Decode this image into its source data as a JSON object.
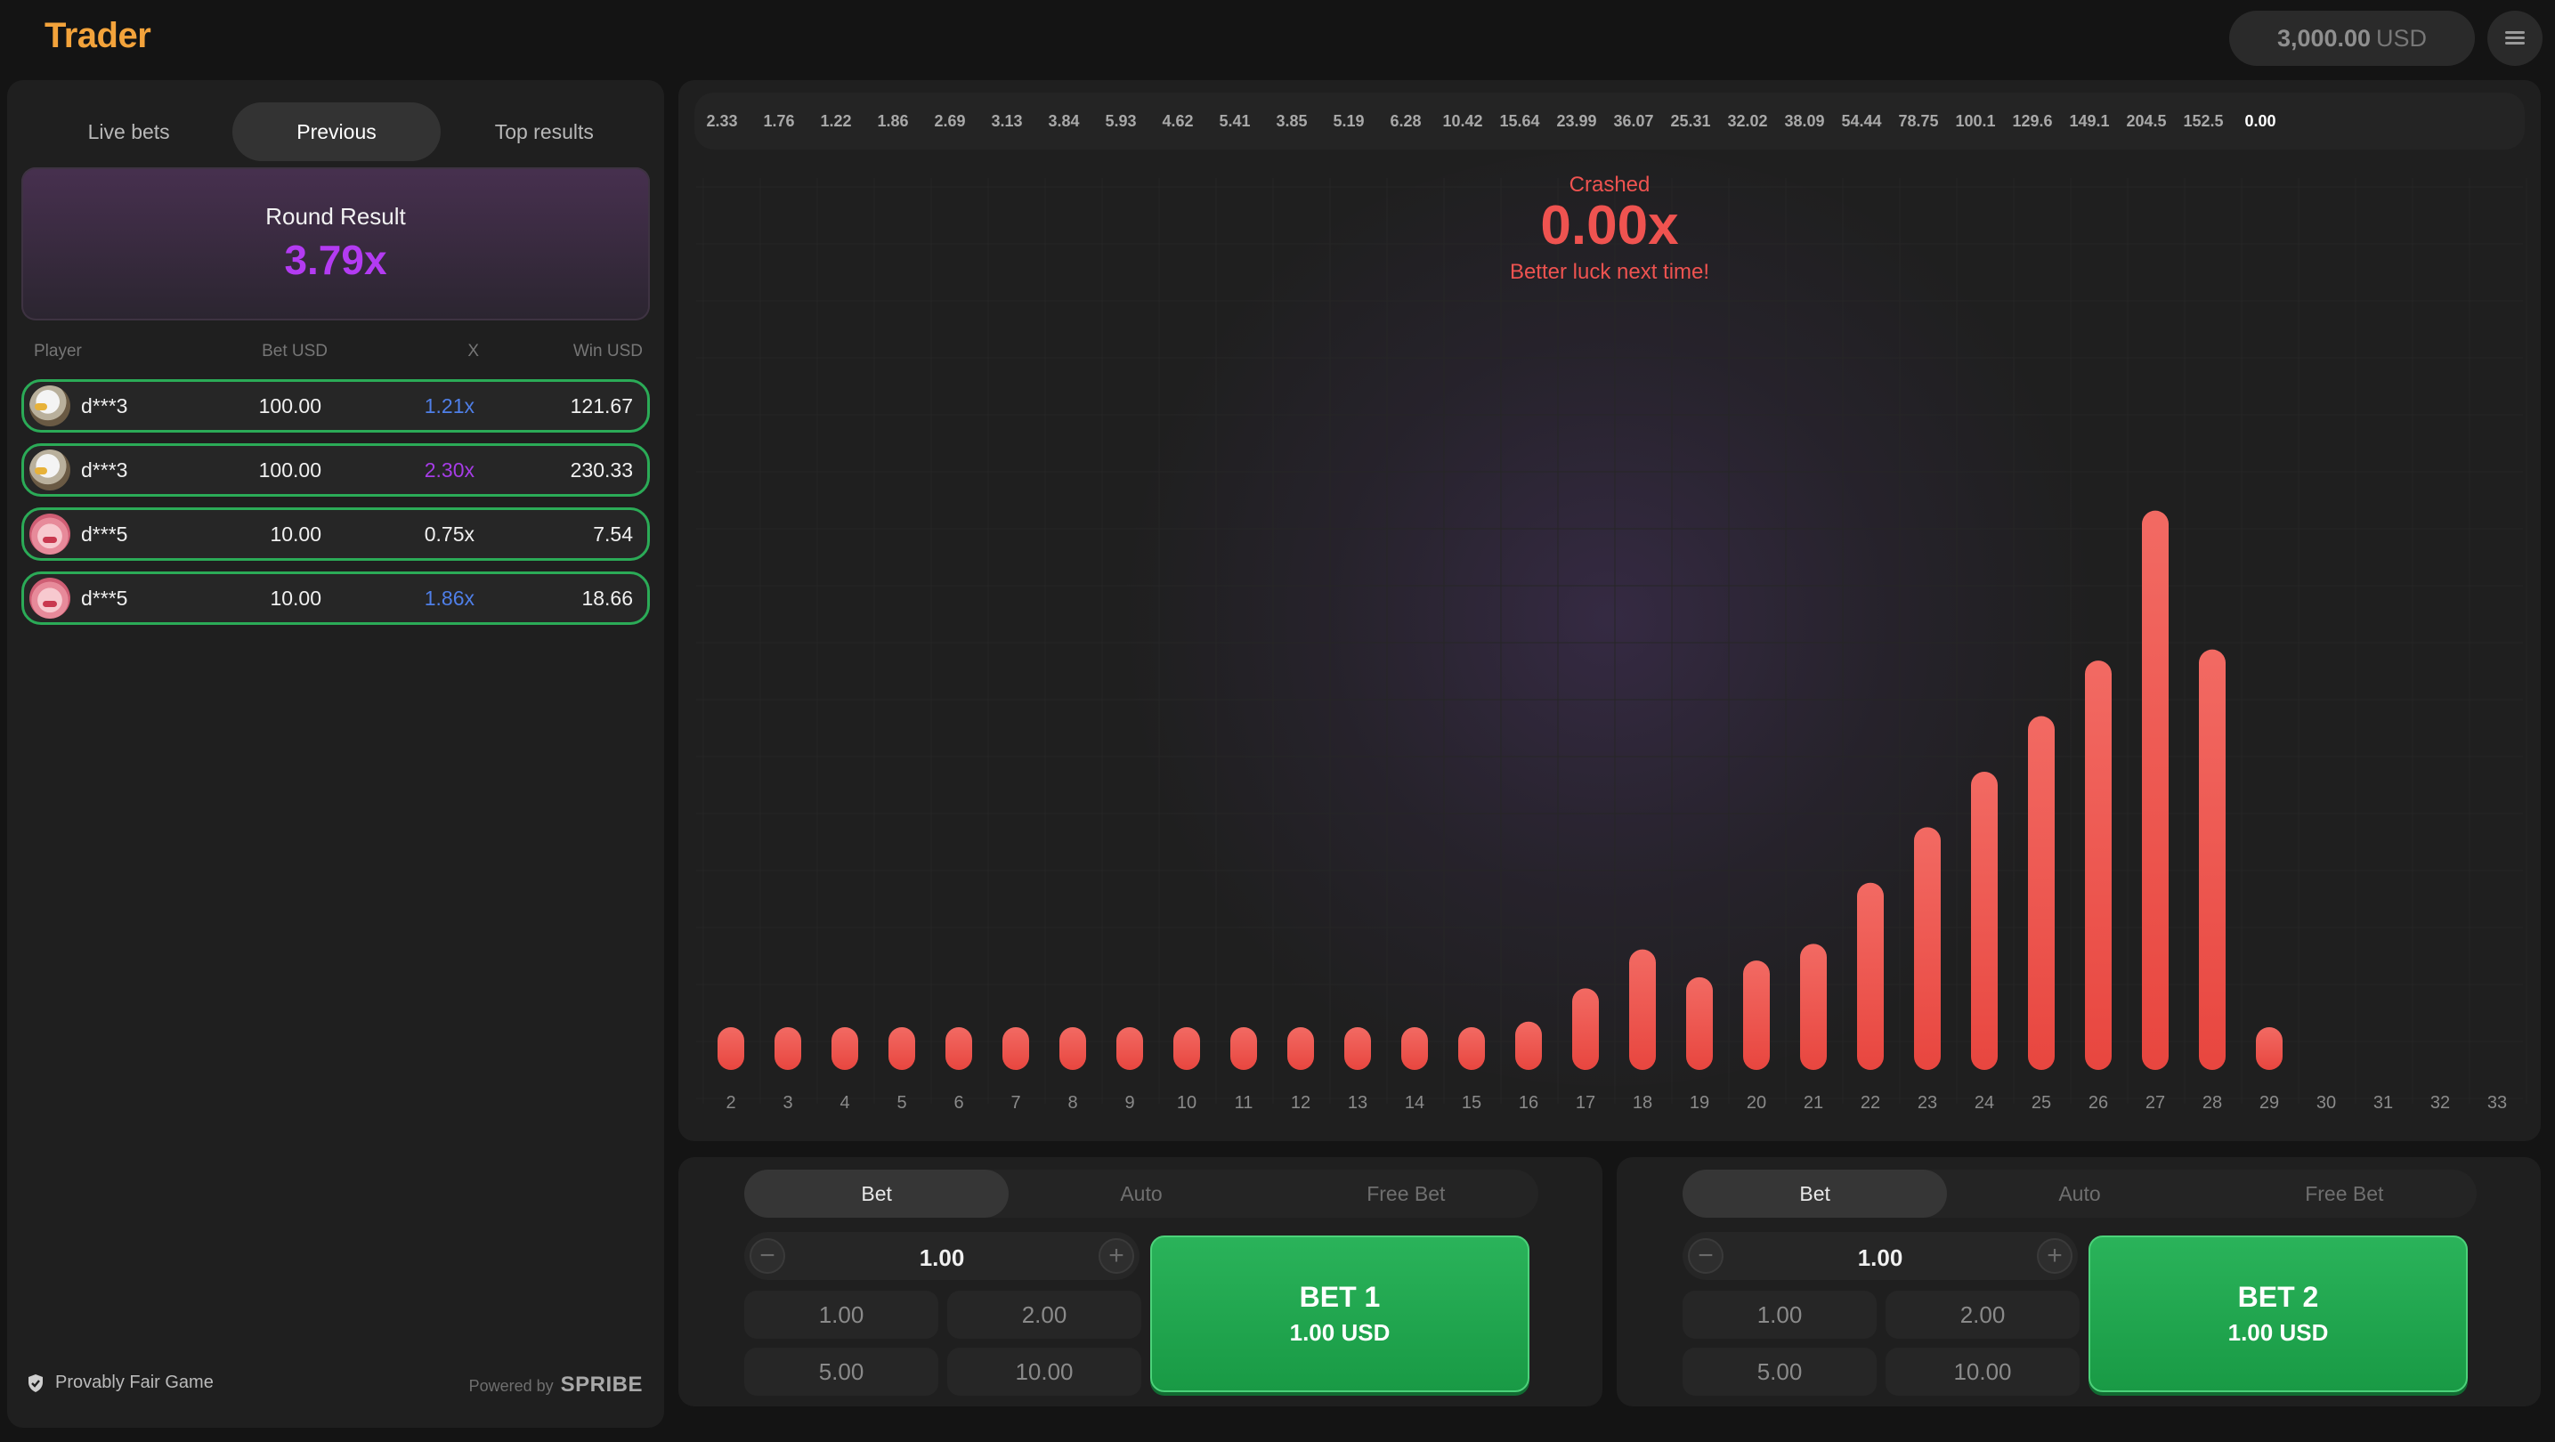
{
  "app": {
    "logo": "Trader"
  },
  "header": {
    "balance_amount": "3,000.00",
    "balance_currency": "USD"
  },
  "left": {
    "tabs": [
      {
        "label": "Live bets",
        "active": false
      },
      {
        "label": "Previous",
        "active": true
      },
      {
        "label": "Top results",
        "active": false
      }
    ],
    "round_result": {
      "title": "Round Result",
      "value": "3.79x"
    },
    "columns": {
      "player": "Player",
      "bet": "Bet USD",
      "x": "X",
      "win": "Win USD"
    },
    "rows": [
      {
        "player": "d***3",
        "avatar": "eagle-avatar",
        "bet": "100.00",
        "x": "1.21x",
        "x_color": "#4f7fe8",
        "win": "121.67"
      },
      {
        "player": "d***3",
        "avatar": "eagle-avatar",
        "bet": "100.00",
        "x": "2.30x",
        "x_color": "#a63ce6",
        "win": "230.33"
      },
      {
        "player": "d***5",
        "avatar": "face-avatar",
        "bet": "10.00",
        "x": "0.75x",
        "x_color": "#f0f0f0",
        "win": "7.54"
      },
      {
        "player": "d***5",
        "avatar": "face-avatar",
        "bet": "10.00",
        "x": "1.86x",
        "x_color": "#4f7fe8",
        "win": "18.66"
      }
    ],
    "footer": {
      "provably_fair": "Provably Fair Game",
      "powered_by": "Powered by",
      "brand": "SPRIBE"
    }
  },
  "history": [
    "2.33",
    "1.76",
    "1.22",
    "1.86",
    "2.69",
    "3.13",
    "3.84",
    "5.93",
    "4.62",
    "5.41",
    "3.85",
    "5.19",
    "6.28",
    "10.42",
    "15.64",
    "23.99",
    "36.07",
    "25.31",
    "32.02",
    "38.09",
    "54.44",
    "78.75",
    "100.1",
    "129.6",
    "149.1",
    "204.5",
    "152.5",
    "0.00"
  ],
  "crash": {
    "label": "Crashed",
    "value": "0.00x",
    "message": "Better luck next time!"
  },
  "colors": {
    "accent": "#f3a33b",
    "bar": "#ef5350",
    "win_border": "#2bab57",
    "bet_button": "#22a852",
    "round_value": "#b33bf2"
  },
  "chart_data": {
    "type": "bar",
    "categories": [
      "2",
      "3",
      "4",
      "5",
      "6",
      "7",
      "8",
      "9",
      "10",
      "11",
      "12",
      "13",
      "14",
      "15",
      "16",
      "17",
      "18",
      "19",
      "20",
      "21",
      "22",
      "23",
      "24",
      "25",
      "26",
      "27",
      "28",
      "29",
      "30",
      "31",
      "32",
      "33"
    ],
    "values": [
      0.0,
      0.0,
      0.0,
      0.0,
      0.0,
      0.0,
      0.0,
      0.0,
      0.0,
      0.0,
      0.0,
      0.0,
      0.0,
      0.0,
      0.1,
      0.7,
      1.4,
      0.9,
      1.2,
      1.5,
      2.6,
      3.6,
      4.6,
      5.6,
      6.6,
      9.3,
      6.8,
      0.0,
      null,
      null,
      null,
      null
    ],
    "ylim": [
      0,
      10
    ],
    "grid": true
  },
  "bets": [
    {
      "tabs": [
        "Bet",
        "Auto",
        "Free Bet"
      ],
      "active_tab": 0,
      "stake": "1.00",
      "minus": "−",
      "plus": "+",
      "quick": [
        "1.00",
        "2.00",
        "5.00",
        "10.00"
      ],
      "button_title": "BET 1",
      "button_amount": "1.00 USD"
    },
    {
      "tabs": [
        "Bet",
        "Auto",
        "Free Bet"
      ],
      "active_tab": 0,
      "stake": "1.00",
      "minus": "−",
      "plus": "+",
      "quick": [
        "1.00",
        "2.00",
        "5.00",
        "10.00"
      ],
      "button_title": "BET 2",
      "button_amount": "1.00 USD"
    }
  ]
}
